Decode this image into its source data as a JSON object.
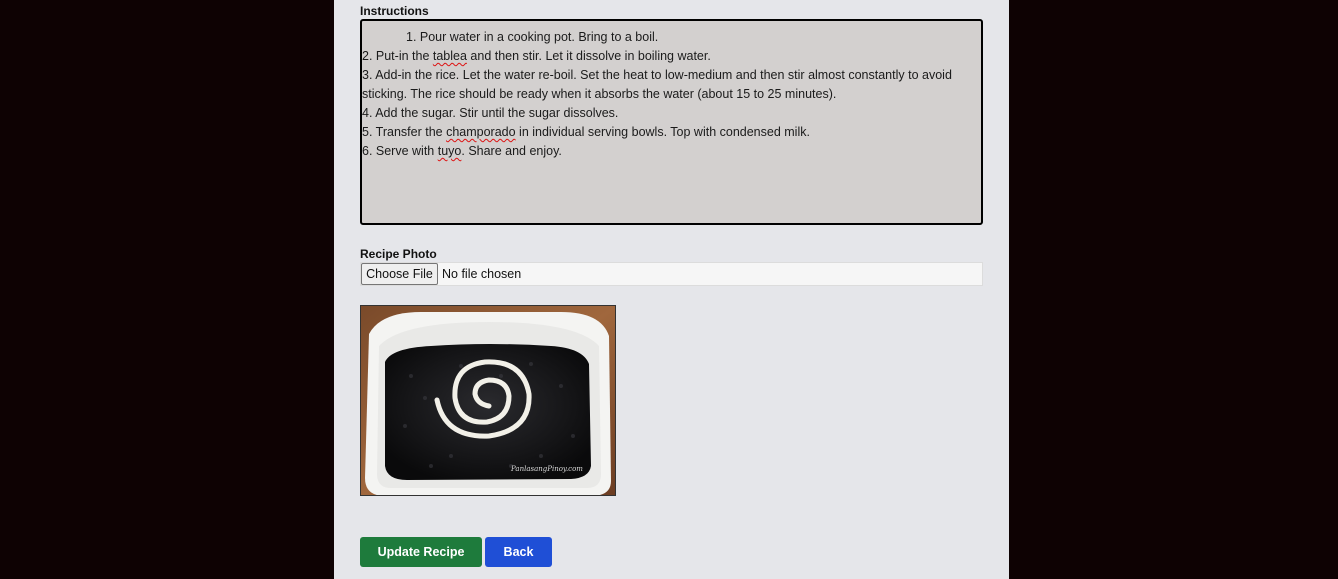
{
  "form": {
    "instructions_label": "Instructions",
    "instructions_lines": [
      "1. Pour water in a cooking pot. Bring to a boil.",
      "2. Put-in the tablea and then stir. Let it dissolve in boiling water.",
      "3. Add-in the rice. Let the water re-boil. Set the heat to low-medium and then stir almost constantly to avoid",
      "sticking. The rice should be ready when it absorbs the water (about 15 to 25 minutes).",
      "4. Add the sugar. Stir until the sugar dissolves.",
      "5. Transfer the champorado in individual serving bowls. Top with condensed milk.",
      "6. Serve with tuyo. Share and enjoy."
    ],
    "photo_label": "Recipe Photo",
    "file_input": {
      "button_label": "Choose File",
      "status": "No file chosen"
    },
    "photo_watermark": "PanlasangPinoy.com",
    "buttons": {
      "update": "Update Recipe",
      "back": "Back"
    }
  },
  "colors": {
    "page_background": "#0e0203",
    "panel_background": "#e5e6ea",
    "textarea_background": "#d3d0cf",
    "update_button": "#1e7b3c",
    "back_button": "#1f4fd6"
  }
}
